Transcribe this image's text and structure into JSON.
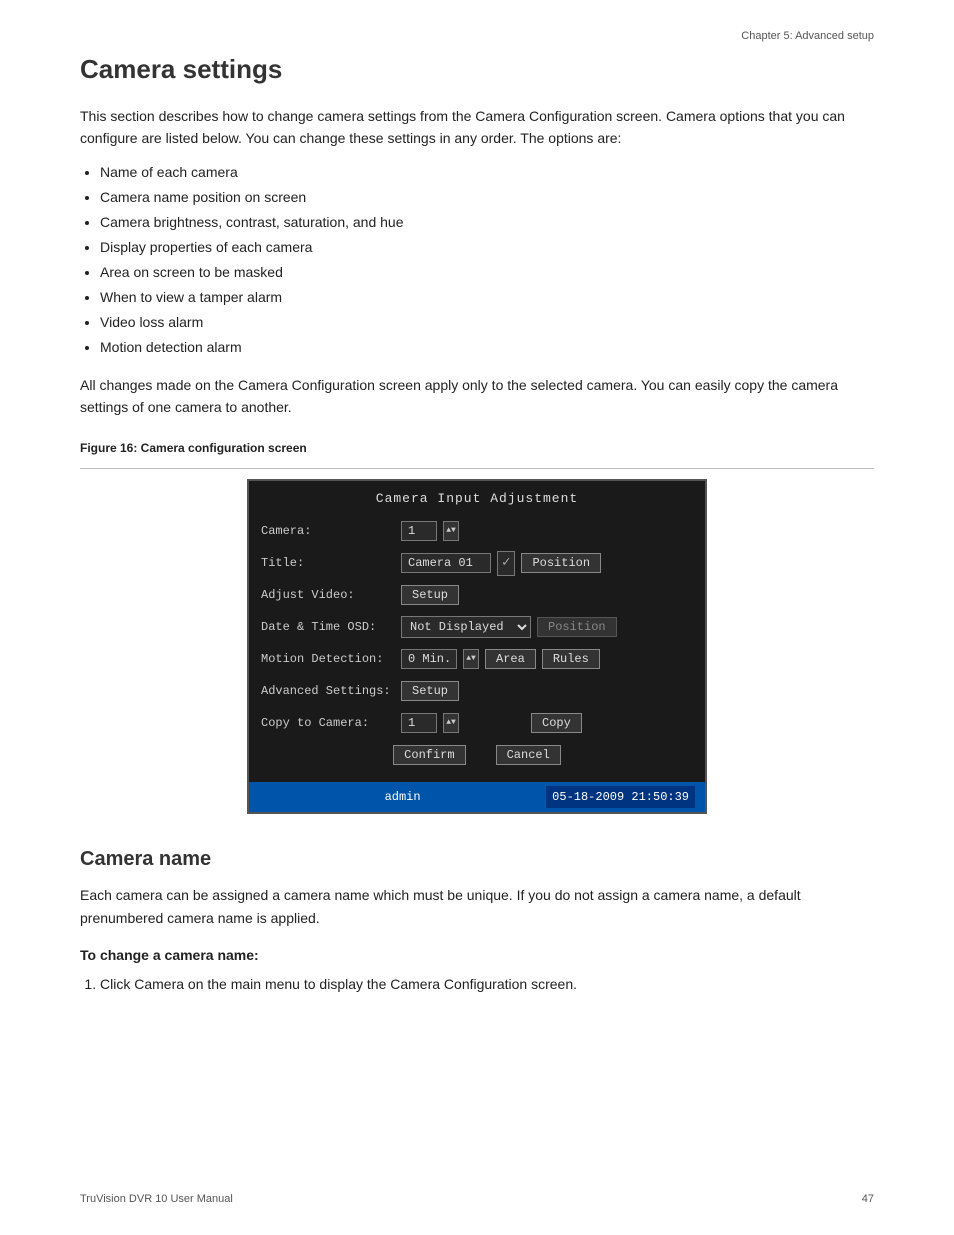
{
  "chapter_header": "Chapter 5: Advanced setup",
  "page_number": "47",
  "footer_left": "TruVision DVR 10 User Manual",
  "section_title": "Camera settings",
  "intro_paragraph": "This section describes how to change camera settings from the Camera Configuration screen. Camera options that you can configure are listed below. You can change these settings in any order. The options are:",
  "bullet_items": [
    "Name of each camera",
    "Camera name position on screen",
    "Camera brightness, contrast, saturation, and hue",
    "Display properties of each camera",
    "Area on screen to be masked",
    "When to view a tamper alarm",
    "Video loss alarm",
    "Motion detection alarm"
  ],
  "all_changes_paragraph": "All changes made on the Camera Configuration screen apply only to the selected camera. You can easily copy the camera settings of one camera to another.",
  "figure_caption": "Figure 16: Camera configuration screen",
  "camera_screen": {
    "title": "Camera Input Adjustment",
    "rows": [
      {
        "label": "Camera:",
        "control_type": "spinner",
        "value": "1"
      },
      {
        "label": "Title:",
        "control_type": "title",
        "value": "Camera 01",
        "extra_btn": "Position"
      },
      {
        "label": "Adjust Video:",
        "control_type": "button",
        "value": "Setup"
      },
      {
        "label": "Date & Time OSD:",
        "control_type": "select",
        "value": "Not Displayed",
        "extra_btn": "Position"
      },
      {
        "label": "Motion Detection:",
        "control_type": "motion",
        "value": "0 Min.",
        "btn1": "Area",
        "btn2": "Rules"
      },
      {
        "label": "Advanced Settings:",
        "control_type": "button",
        "value": "Setup"
      },
      {
        "label": "Copy to Camera:",
        "control_type": "copy",
        "value": "1",
        "copy_btn": "Copy"
      }
    ],
    "confirm_btn": "Confirm",
    "cancel_btn": "Cancel",
    "footer_admin": "admin",
    "footer_datetime": "05-18-2009 21:50:39"
  },
  "subsection_title": "Camera name",
  "camera_name_paragraph": "Each camera can be assigned a camera name which must be unique. If you do not assign a camera name, a default prenumbered camera name is applied.",
  "procedure_title": "To change a camera name:",
  "steps": [
    "Click Camera on the main menu to display the Camera Configuration screen."
  ]
}
